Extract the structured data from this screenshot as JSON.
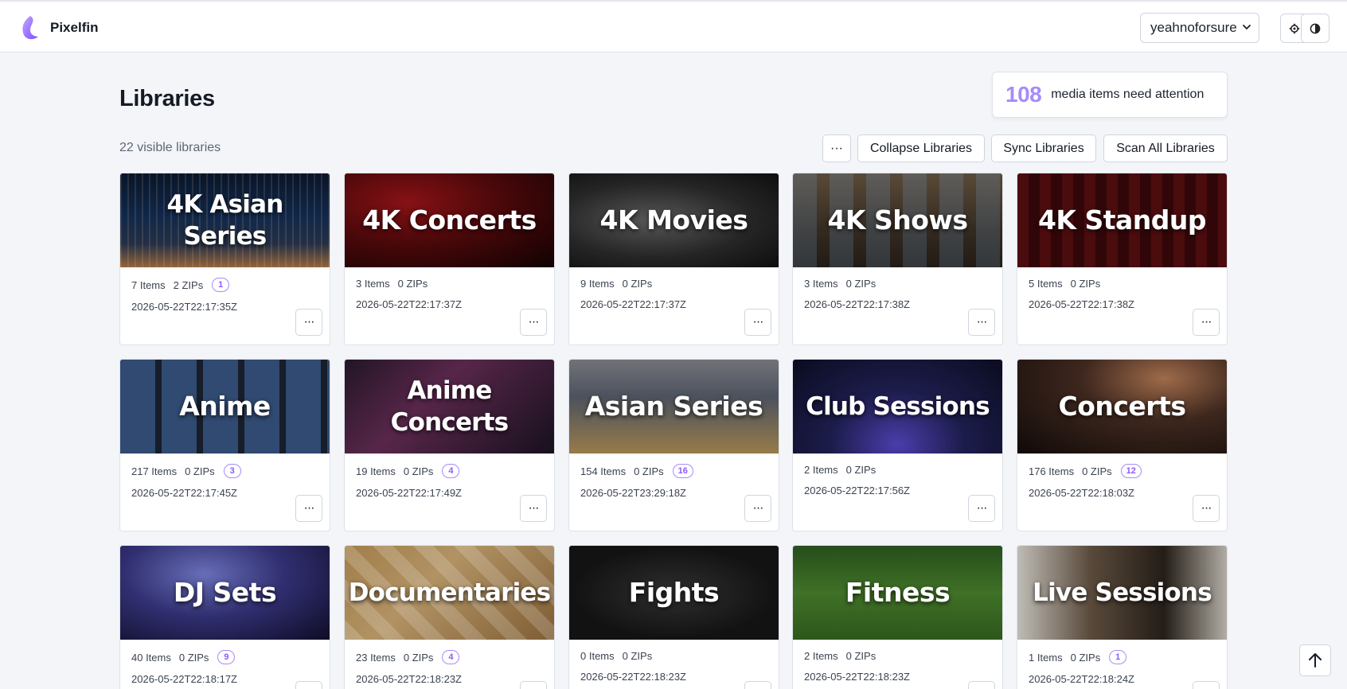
{
  "app": {
    "name": "Pixelfin"
  },
  "header": {
    "user": "yeahnoforsure",
    "settings_icon": "gear-icon",
    "theme_icon": "contrast-icon"
  },
  "page": {
    "title": "Libraries",
    "attention_count": "108",
    "attention_label": "media items need attention",
    "visible_count": "22 visible libraries"
  },
  "toolbar": {
    "more_label": "···",
    "collapse_label": "Collapse Libraries",
    "sync_label": "Sync Libraries",
    "scan_label": "Scan All Libraries"
  },
  "card_menu_label": "···",
  "colors": {
    "accent": "#a78bfa",
    "badge_border": "#a78bfa"
  },
  "libraries": [
    {
      "name": "4K Asian Series",
      "items": "7 Items",
      "zips": "2 ZIPs",
      "badge": "1",
      "date": "2026-05-22T22:17:35Z"
    },
    {
      "name": "4K Concerts",
      "items": "3 Items",
      "zips": "0 ZIPs",
      "badge": "",
      "date": "2026-05-22T22:17:37Z"
    },
    {
      "name": "4K Movies",
      "items": "9 Items",
      "zips": "0 ZIPs",
      "badge": "",
      "date": "2026-05-22T22:17:37Z"
    },
    {
      "name": "4K Shows",
      "items": "3 Items",
      "zips": "0 ZIPs",
      "badge": "",
      "date": "2026-05-22T22:17:38Z"
    },
    {
      "name": "4K Standup",
      "items": "5 Items",
      "zips": "0 ZIPs",
      "badge": "",
      "date": "2026-05-22T22:17:38Z"
    },
    {
      "name": "Anime",
      "items": "217 Items",
      "zips": "0 ZIPs",
      "badge": "3",
      "date": "2026-05-22T22:17:45Z"
    },
    {
      "name": "Anime Concerts",
      "items": "19 Items",
      "zips": "0 ZIPs",
      "badge": "4",
      "date": "2026-05-22T22:17:49Z"
    },
    {
      "name": "Asian Series",
      "items": "154 Items",
      "zips": "0 ZIPs",
      "badge": "16",
      "date": "2026-05-22T23:29:18Z"
    },
    {
      "name": "Club Sessions",
      "items": "2 Items",
      "zips": "0 ZIPs",
      "badge": "",
      "date": "2026-05-22T22:17:56Z"
    },
    {
      "name": "Concerts",
      "items": "176 Items",
      "zips": "0 ZIPs",
      "badge": "12",
      "date": "2026-05-22T22:18:03Z"
    },
    {
      "name": "DJ Sets",
      "items": "40 Items",
      "zips": "0 ZIPs",
      "badge": "9",
      "date": "2026-05-22T22:18:17Z"
    },
    {
      "name": "Documentaries",
      "items": "23 Items",
      "zips": "0 ZIPs",
      "badge": "4",
      "date": "2026-05-22T22:18:23Z"
    },
    {
      "name": "Fights",
      "items": "0 Items",
      "zips": "0 ZIPs",
      "badge": "",
      "date": "2026-05-22T22:18:23Z"
    },
    {
      "name": "Fitness",
      "items": "2 Items",
      "zips": "0 ZIPs",
      "badge": "",
      "date": "2026-05-22T22:18:23Z"
    },
    {
      "name": "Live Sessions",
      "items": "1 Items",
      "zips": "0 ZIPs",
      "badge": "1",
      "date": "2026-05-22T22:18:24Z"
    }
  ]
}
